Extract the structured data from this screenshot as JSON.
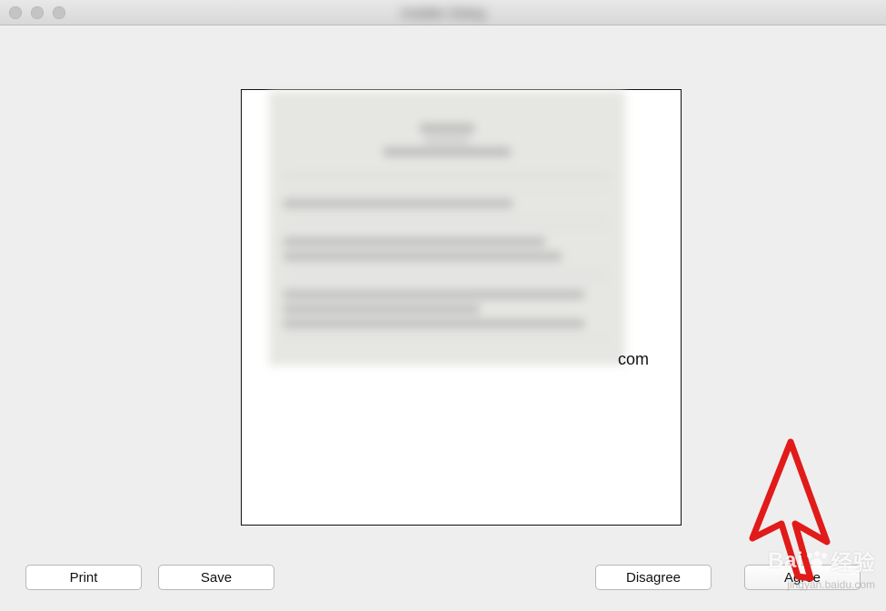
{
  "window": {
    "title": "Installer Dialog"
  },
  "license": {
    "visible_partial_text": "com"
  },
  "buttons": {
    "print": "Print",
    "save": "Save",
    "disagree": "Disagree",
    "agree": "Agree"
  },
  "watermark": {
    "brand_prefix": "Bai",
    "brand_suffix": "经验",
    "subtext": "jingyan.baidu.com"
  }
}
